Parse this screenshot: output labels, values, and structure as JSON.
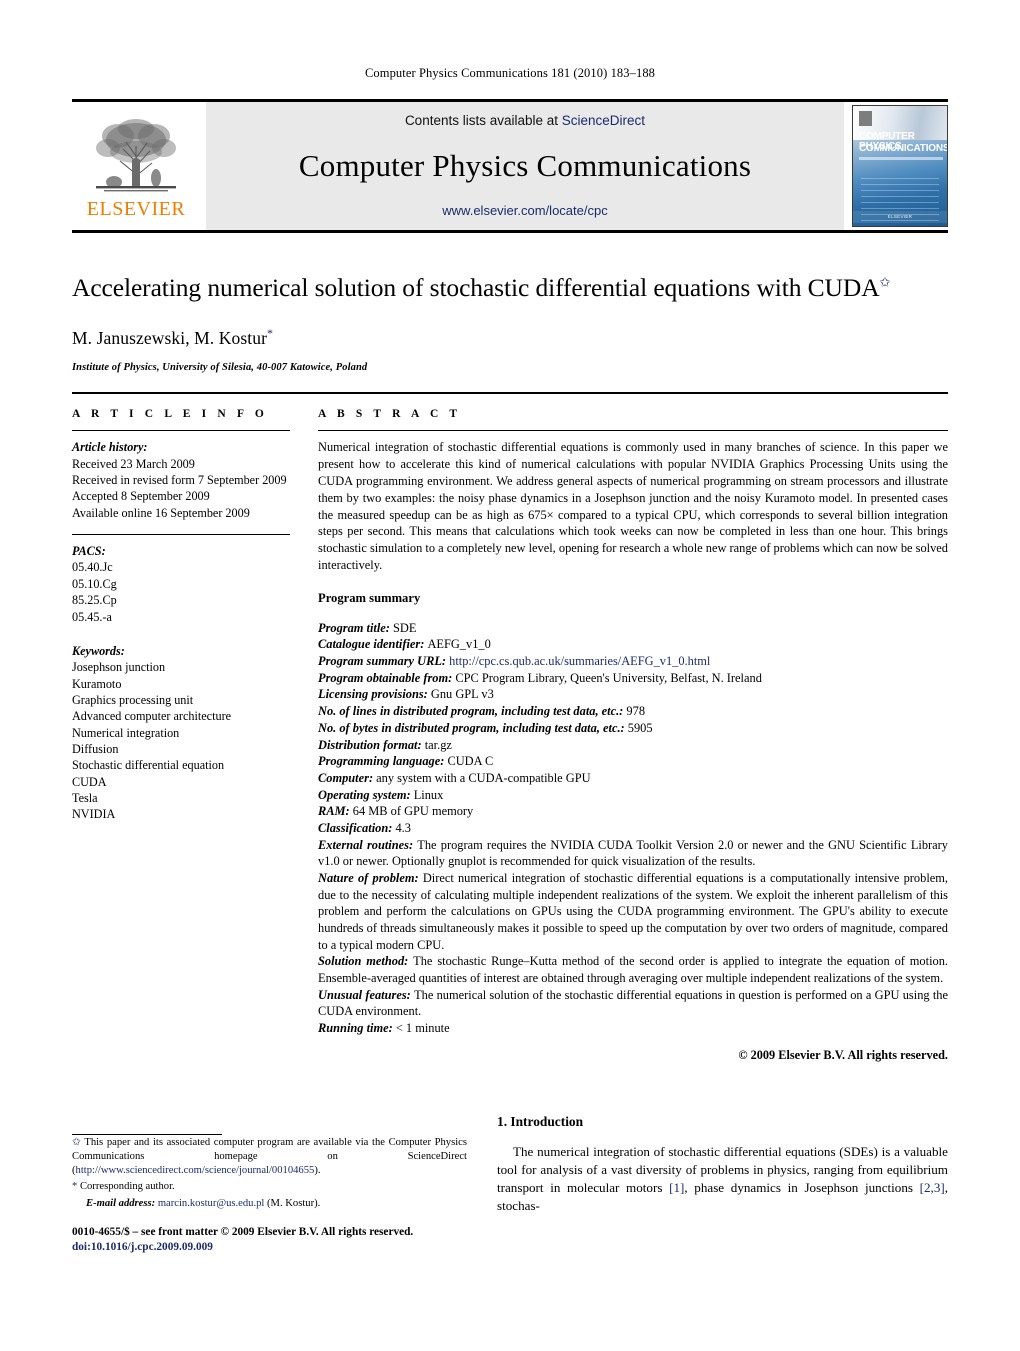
{
  "running_head": "Computer Physics Communications 181 (2010) 183–188",
  "masthead": {
    "publisher_name": "ELSEVIER",
    "contents_line_prefix": "Contents lists available at ",
    "contents_link": "ScienceDirect",
    "journal_title": "Computer Physics Communications",
    "journal_url": "www.elsevier.com/locate/cpc",
    "cover": {
      "line1": "COMPUTER PHYSICS",
      "line2": "COMMUNICATIONS",
      "footer": "ELSEVIER"
    }
  },
  "article": {
    "title": "Accelerating numerical solution of stochastic differential equations with CUDA",
    "title_mark": "✩",
    "authors": "M. Januszewski, M. Kostur",
    "author_mark": "*",
    "affiliation": "Institute of Physics, University of Silesia, 40-007 Katowice, Poland"
  },
  "article_info": {
    "heading": "A R T I C L E   I N F O",
    "history_label": "Article history:",
    "history": [
      "Received 23 March 2009",
      "Received in revised form 7 September 2009",
      "Accepted 8 September 2009",
      "Available online 16 September 2009"
    ],
    "pacs_label": "PACS:",
    "pacs": [
      "05.40.Jc",
      "05.10.Cg",
      "85.25.Cp",
      "05.45.-a"
    ],
    "keywords_label": "Keywords:",
    "keywords": [
      "Josephson junction",
      "Kuramoto",
      "Graphics processing unit",
      "Advanced computer architecture",
      "Numerical integration",
      "Diffusion",
      "Stochastic differential equation",
      "CUDA",
      "Tesla",
      "NVIDIA"
    ]
  },
  "abstract": {
    "heading": "A B S T R A C T",
    "text": "Numerical integration of stochastic differential equations is commonly used in many branches of science. In this paper we present how to accelerate this kind of numerical calculations with popular NVIDIA Graphics Processing Units using the CUDA programming environment. We address general aspects of numerical programming on stream processors and illustrate them by two examples: the noisy phase dynamics in a Josephson junction and the noisy Kuramoto model. In presented cases the measured speedup can be as high as 675× compared to a typical CPU, which corresponds to several billion integration steps per second. This means that calculations which took weeks can now be completed in less than one hour. This brings stochastic simulation to a completely new level, opening for research a whole new range of problems which can now be solved interactively."
  },
  "program_summary": {
    "heading": "Program summary",
    "fields": [
      {
        "label": "Program title:",
        "value": "SDE"
      },
      {
        "label": "Catalogue identifier:",
        "value": "AEFG_v1_0"
      },
      {
        "label": "Program summary URL:",
        "value": "http://cpc.cs.qub.ac.uk/summaries/AEFG_v1_0.html",
        "is_link": true
      },
      {
        "label": "Program obtainable from:",
        "value": "CPC Program Library, Queen's University, Belfast, N. Ireland"
      },
      {
        "label": "Licensing provisions:",
        "value": "Gnu GPL v3"
      },
      {
        "label": "No. of lines in distributed program, including test data, etc.:",
        "value": "978"
      },
      {
        "label": "No. of bytes in distributed program, including test data, etc.:",
        "value": "5905"
      },
      {
        "label": "Distribution format:",
        "value": "tar.gz"
      },
      {
        "label": "Programming language:",
        "value": "CUDA C"
      },
      {
        "label": "Computer:",
        "value": "any system with a CUDA-compatible GPU"
      },
      {
        "label": "Operating system:",
        "value": "Linux"
      },
      {
        "label": "RAM:",
        "value": "64 MB of GPU memory"
      },
      {
        "label": "Classification:",
        "value": "4.3"
      },
      {
        "label": "External routines:",
        "value": "The program requires the NVIDIA CUDA Toolkit Version 2.0 or newer and the GNU Scientific Library v1.0 or newer. Optionally gnuplot is recommended for quick visualization of the results."
      },
      {
        "label": "Nature of problem:",
        "value": "Direct numerical integration of stochastic differential equations is a computationally intensive problem, due to the necessity of calculating multiple independent realizations of the system. We exploit the inherent parallelism of this problem and perform the calculations on GPUs using the CUDA programming environment. The GPU's ability to execute hundreds of threads simultaneously makes it possible to speed up the computation by over two orders of magnitude, compared to a typical modern CPU."
      },
      {
        "label": "Solution method:",
        "value": "The stochastic Runge–Kutta method of the second order is applied to integrate the equation of motion. Ensemble-averaged quantities of interest are obtained through averaging over multiple independent realizations of the system."
      },
      {
        "label": "Unusual features:",
        "value": "The numerical solution of the stochastic differential equations in question is performed on a GPU using the CUDA environment."
      },
      {
        "label": "Running time:",
        "value": "< 1 minute"
      }
    ],
    "copyright": "© 2009 Elsevier B.V. All rights reserved."
  },
  "footnote": {
    "star_symbol": "✩",
    "star_text_before": " This paper and its associated computer program are available via the Computer Physics Communications homepage on ScienceDirect (",
    "star_link": "http://www.sciencedirect.com/science/journal/00104655",
    "star_text_after": ").",
    "corr_symbol": "*",
    "corr_text": " Corresponding author.",
    "email_label": "E-mail address:",
    "email": "marcin.kostur@us.edu.pl",
    "email_suffix": " (M. Kostur)."
  },
  "imprint": {
    "line1": "0010-4655/$ – see front matter © 2009 Elsevier B.V. All rights reserved.",
    "doi": "doi:10.1016/j.cpc.2009.09.009"
  },
  "introduction": {
    "number_title": "1. Introduction",
    "paragraph_parts": [
      {
        "text": "The numerical integration of stochastic differential equations (SDEs) is a valuable tool for analysis of a vast diversity of problems in physics, ranging from equilibrium transport in molecular motors "
      },
      {
        "text": "[1]",
        "is_link": true
      },
      {
        "text": ", phase dynamics in Josephson junctions "
      },
      {
        "text": "[2,3]",
        "is_link": true
      },
      {
        "text": ", stochas-"
      }
    ]
  },
  "colors": {
    "link": "#1a2b6d",
    "elsevier_orange": "#f07d00",
    "band_gray": "#e9e9e9"
  }
}
